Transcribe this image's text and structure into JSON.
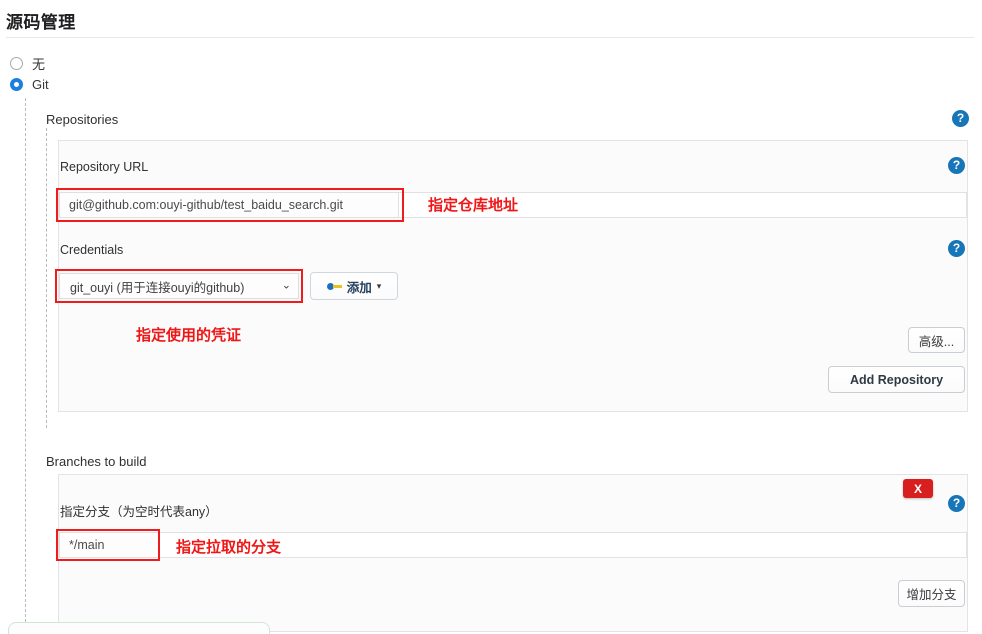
{
  "page": {
    "section_title": "源码管理"
  },
  "scm_radio": {
    "options": [
      {
        "label": "无",
        "checked": false
      },
      {
        "label": "Git",
        "checked": true
      }
    ]
  },
  "repositories": {
    "label": "Repositories",
    "help": "?",
    "repository_url": {
      "label": "Repository URL",
      "value": "git@github.com:ouyi-github/test_baidu_search.git",
      "help": "?"
    },
    "credentials": {
      "label": "Credentials",
      "selected": "git_ouyi (用于连接ouyi的github)",
      "caret": "⌄",
      "add_button": "添加",
      "add_caret": "▾",
      "help": "?"
    },
    "advanced_button": "高级...",
    "add_repository_button": "Add Repository"
  },
  "branches": {
    "label": "Branches to build",
    "delete_badge": "X",
    "help": "?",
    "branch_specifier": {
      "label": "指定分支（为空时代表any）",
      "value": "*/main"
    },
    "add_branch_button": "增加分支"
  },
  "annotations": [
    {
      "text": "指定仓库地址"
    },
    {
      "text": "指定使用的凭证"
    },
    {
      "text": "指定拉取的分支"
    }
  ],
  "colors": {
    "accent_blue": "#1676b8",
    "radio_blue": "#1d7fe0",
    "annotation_red": "#f01616",
    "delete_red": "#d81f1f"
  }
}
